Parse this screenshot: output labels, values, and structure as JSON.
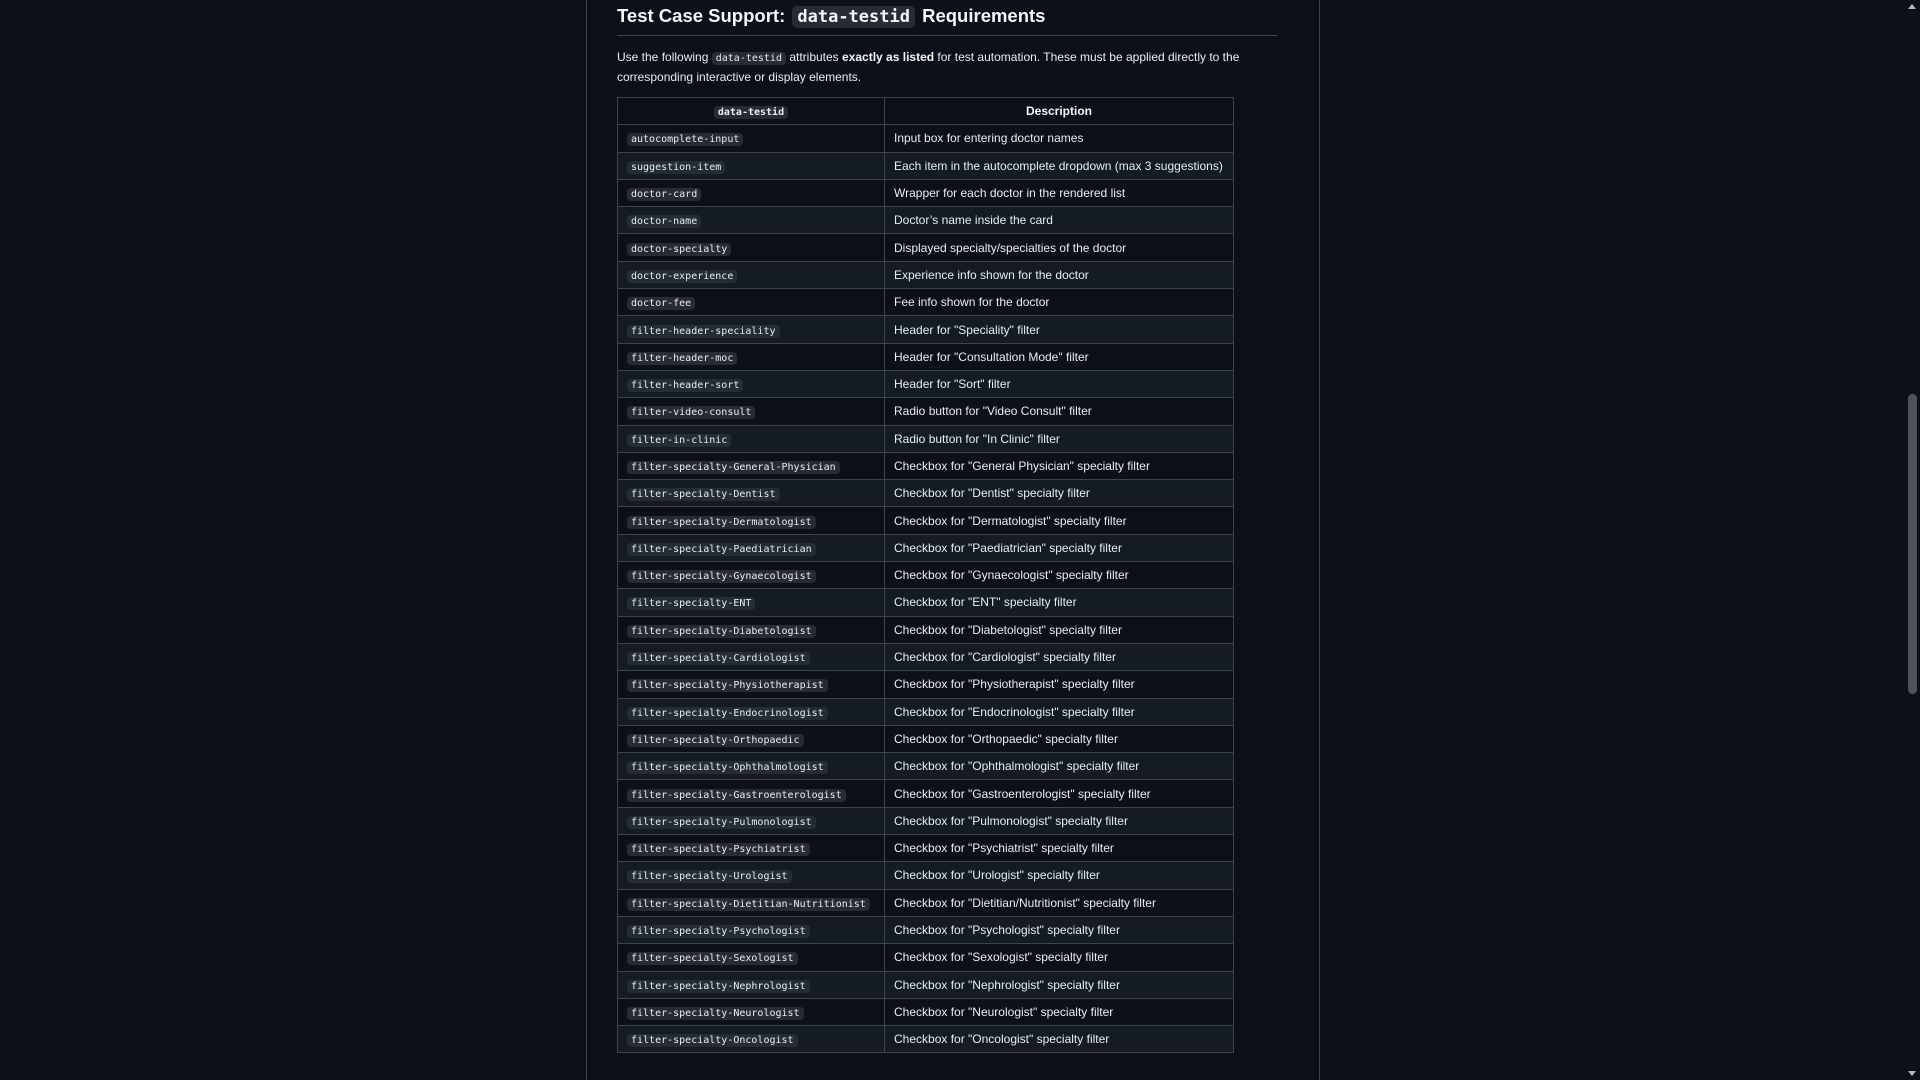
{
  "section": {
    "title_prefix": "Test Case Support:",
    "title_code": "data-testid",
    "title_suffix": "Requirements",
    "intro_before": "Use the following",
    "intro_code": "data-testid",
    "intro_middle": "attributes",
    "intro_bold": "exactly as listed",
    "intro_after": "for test automation. These must be applied directly to the corresponding interactive or display elements."
  },
  "table": {
    "headers": [
      "data-testid",
      "Description"
    ],
    "rows": [
      {
        "id": "autocomplete-input",
        "desc": "Input box for entering doctor names"
      },
      {
        "id": "suggestion-item",
        "desc": "Each item in the autocomplete dropdown (max 3 suggestions)"
      },
      {
        "id": "doctor-card",
        "desc": "Wrapper for each doctor in the rendered list"
      },
      {
        "id": "doctor-name",
        "desc": "Doctor’s name inside the card"
      },
      {
        "id": "doctor-specialty",
        "desc": "Displayed specialty/specialties of the doctor"
      },
      {
        "id": "doctor-experience",
        "desc": "Experience info shown for the doctor"
      },
      {
        "id": "doctor-fee",
        "desc": "Fee info shown for the doctor"
      },
      {
        "id": "filter-header-speciality",
        "desc": "Header for \"Speciality\" filter"
      },
      {
        "id": "filter-header-moc",
        "desc": "Header for \"Consultation Mode\" filter"
      },
      {
        "id": "filter-header-sort",
        "desc": "Header for \"Sort\" filter"
      },
      {
        "id": "filter-video-consult",
        "desc": "Radio button for \"Video Consult\" filter"
      },
      {
        "id": "filter-in-clinic",
        "desc": "Radio button for \"In Clinic\" filter"
      },
      {
        "id": "filter-specialty-General-Physician",
        "desc": "Checkbox for \"General Physician\" specialty filter"
      },
      {
        "id": "filter-specialty-Dentist",
        "desc": "Checkbox for \"Dentist\" specialty filter"
      },
      {
        "id": "filter-specialty-Dermatologist",
        "desc": "Checkbox for \"Dermatologist\" specialty filter"
      },
      {
        "id": "filter-specialty-Paediatrician",
        "desc": "Checkbox for \"Paediatrician\" specialty filter"
      },
      {
        "id": "filter-specialty-Gynaecologist",
        "desc": "Checkbox for \"Gynaecologist\" specialty filter"
      },
      {
        "id": "filter-specialty-ENT",
        "desc": "Checkbox for \"ENT\" specialty filter"
      },
      {
        "id": "filter-specialty-Diabetologist",
        "desc": "Checkbox for \"Diabetologist\" specialty filter"
      },
      {
        "id": "filter-specialty-Cardiologist",
        "desc": "Checkbox for \"Cardiologist\" specialty filter"
      },
      {
        "id": "filter-specialty-Physiotherapist",
        "desc": "Checkbox for \"Physiotherapist\" specialty filter"
      },
      {
        "id": "filter-specialty-Endocrinologist",
        "desc": "Checkbox for \"Endocrinologist\" specialty filter"
      },
      {
        "id": "filter-specialty-Orthopaedic",
        "desc": "Checkbox for \"Orthopaedic\" specialty filter"
      },
      {
        "id": "filter-specialty-Ophthalmologist",
        "desc": "Checkbox for \"Ophthalmologist\" specialty filter"
      },
      {
        "id": "filter-specialty-Gastroenterologist",
        "desc": "Checkbox for \"Gastroenterologist\" specialty filter"
      },
      {
        "id": "filter-specialty-Pulmonologist",
        "desc": "Checkbox for \"Pulmonologist\" specialty filter"
      },
      {
        "id": "filter-specialty-Psychiatrist",
        "desc": "Checkbox for \"Psychiatrist\" specialty filter"
      },
      {
        "id": "filter-specialty-Urologist",
        "desc": "Checkbox for \"Urologist\" specialty filter"
      },
      {
        "id": "filter-specialty-Dietitian-Nutritionist",
        "desc": "Checkbox for \"Dietitian/Nutritionist\" specialty filter"
      },
      {
        "id": "filter-specialty-Psychologist",
        "desc": "Checkbox for \"Psychologist\" specialty filter"
      },
      {
        "id": "filter-specialty-Sexologist",
        "desc": "Checkbox for \"Sexologist\" specialty filter"
      },
      {
        "id": "filter-specialty-Nephrologist",
        "desc": "Checkbox for \"Nephrologist\" specialty filter"
      },
      {
        "id": "filter-specialty-Neurologist",
        "desc": "Checkbox for \"Neurologist\" specialty filter"
      },
      {
        "id": "filter-specialty-Oncologist",
        "desc": "Checkbox for \"Oncologist\" specialty filter"
      }
    ]
  },
  "colors": {
    "background": "#0d1117",
    "border": "#3d444d",
    "code_background": "#262c36",
    "text": "#e6edf3"
  }
}
